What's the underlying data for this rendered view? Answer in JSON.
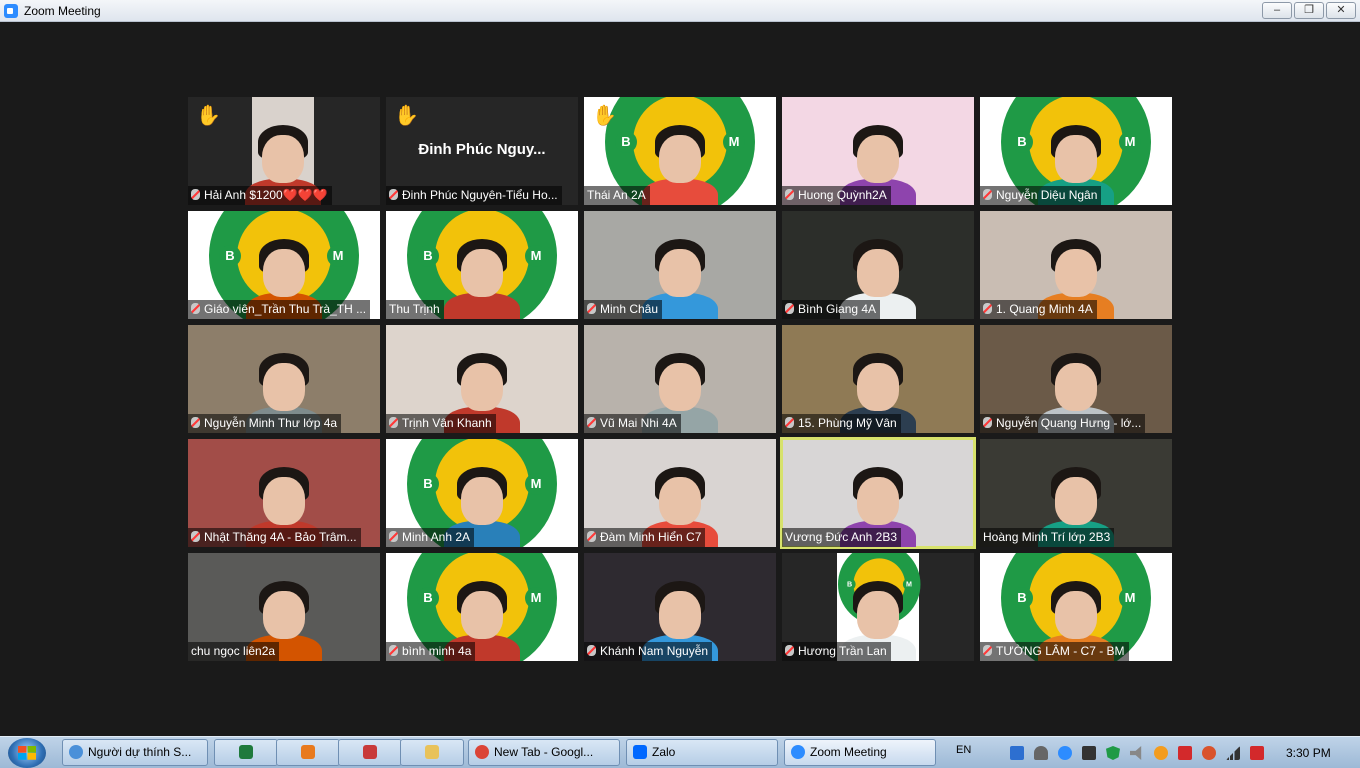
{
  "window": {
    "title": "Zoom Meeting",
    "controls": {
      "minimize": "–",
      "restore": "❐",
      "close": "✕"
    }
  },
  "participants": [
    {
      "name": "Hải Anh $1200❤️❤️❤️",
      "muted": true,
      "hand_raised": true,
      "video": "face",
      "bg": "#262626"
    },
    {
      "name": "Đinh Phúc Nguyên-Tiểu Ho...",
      "muted": true,
      "hand_raised": true,
      "video": "none",
      "display_name": "Đinh Phúc Nguy..."
    },
    {
      "name": "Thái An 2A",
      "muted": false,
      "hand_raised": true,
      "video": "logo"
    },
    {
      "name": "Huong Quỳnh2A",
      "muted": true,
      "hand_raised": false,
      "video": "face",
      "bg": "#f3d7e4"
    },
    {
      "name": "Nguyễn Diệu Ngân",
      "muted": true,
      "hand_raised": false,
      "video": "logo"
    },
    {
      "name": "Giáo viên_Trần Thu Trà_TH ...",
      "muted": true,
      "hand_raised": false,
      "video": "logo"
    },
    {
      "name": "Thu Trịnh",
      "muted": false,
      "hand_raised": false,
      "video": "logo"
    },
    {
      "name": "Minh Châu",
      "muted": true,
      "hand_raised": false,
      "video": "face",
      "bg": "#a8a8a4"
    },
    {
      "name": "Bình Giang 4A",
      "muted": true,
      "hand_raised": false,
      "video": "face",
      "bg": "#2c2e2a"
    },
    {
      "name": "1. Quang Minh 4A",
      "muted": true,
      "hand_raised": false,
      "video": "face",
      "bg": "#c9bdb3"
    },
    {
      "name": "Nguyễn Minh Thư lớp 4a",
      "muted": true,
      "hand_raised": false,
      "video": "face",
      "bg": "#8d7e6a"
    },
    {
      "name": "Trịnh Vân Khanh",
      "muted": true,
      "hand_raised": false,
      "video": "face",
      "bg": "#ddd4cc"
    },
    {
      "name": "Vũ Mai Nhi 4A",
      "muted": true,
      "hand_raised": false,
      "video": "face",
      "bg": "#b8b2ab"
    },
    {
      "name": "15. Phùng Mỹ Vân",
      "muted": true,
      "hand_raised": false,
      "video": "face",
      "bg": "#8f7a55"
    },
    {
      "name": "Nguyễn Quang Hưng  - lớ...",
      "muted": true,
      "hand_raised": false,
      "video": "face",
      "bg": "#6b5a48"
    },
    {
      "name": "Nhật Thăng 4A - Bảo Trâm...",
      "muted": true,
      "hand_raised": false,
      "video": "face",
      "bg": "#a24d48"
    },
    {
      "name": "Minh Anh 2A",
      "muted": true,
      "hand_raised": false,
      "video": "logo"
    },
    {
      "name": "Đàm Minh Hiển C7",
      "muted": true,
      "hand_raised": false,
      "video": "face",
      "bg": "#d9d4d2"
    },
    {
      "name": "Vương Đức Anh 2B3",
      "muted": false,
      "hand_raised": false,
      "video": "face",
      "bg": "#d8d6d6",
      "active": true
    },
    {
      "name": "Hoàng Minh Trí lớp 2B3",
      "muted": false,
      "hand_raised": false,
      "video": "face",
      "bg": "#3a3a34"
    },
    {
      "name": "chu ngọc liên2a",
      "muted": false,
      "hand_raised": false,
      "video": "face",
      "bg": "#5a5a58"
    },
    {
      "name": "bình minh 4a",
      "muted": true,
      "hand_raised": false,
      "video": "logo"
    },
    {
      "name": "Khánh Nam Nguyễn",
      "muted": true,
      "hand_raised": false,
      "video": "face",
      "bg": "#2e2a30"
    },
    {
      "name": "Hương Trần Lan",
      "muted": true,
      "hand_raised": false,
      "video": "logo-small"
    },
    {
      "name": "TƯỜNG LÂM - C7 - BM",
      "muted": true,
      "hand_raised": false,
      "video": "logo"
    }
  ],
  "logo": {
    "b": "B",
    "m": "M",
    "accent": "#1f9a46",
    "yellow": "#f2c20a"
  },
  "taskbar": {
    "items": [
      {
        "label": "Người dự thính S...",
        "icon": "zoom-participants-icon",
        "color": "#4a90d9"
      },
      {
        "label": "",
        "icon": "excel-icon",
        "color": "#1f7a3c"
      },
      {
        "label": "",
        "icon": "media-player-icon",
        "color": "#e87a1e"
      },
      {
        "label": "",
        "icon": "app-grid-icon",
        "color": "#c83a3a"
      },
      {
        "label": "",
        "icon": "folder-icon",
        "color": "#e8c25a"
      },
      {
        "label": "New Tab - Googl...",
        "icon": "chrome-icon",
        "color": "#db4437"
      },
      {
        "label": "Zalo",
        "icon": "zalo-icon",
        "color": "#0068ff"
      },
      {
        "label": "Zoom Meeting",
        "icon": "zoom-icon",
        "color": "#2d8cff"
      }
    ],
    "language": "EN",
    "clock": "3:30 PM"
  }
}
